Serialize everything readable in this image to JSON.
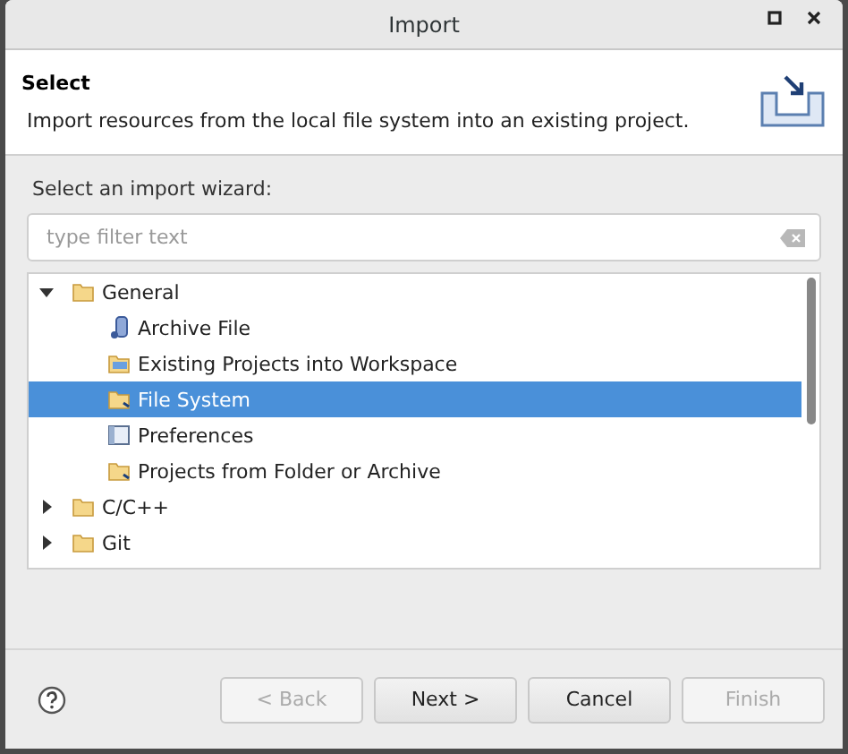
{
  "window": {
    "title": "Import"
  },
  "header": {
    "title": "Select",
    "description": "Import resources from the local file system into an existing project."
  },
  "wizard_label": "Select an import wizard:",
  "filter": {
    "placeholder": "type filter text"
  },
  "tree": [
    {
      "label": "General",
      "expanded": true,
      "selected": false,
      "children": [
        {
          "label": "Archive File",
          "kind": "archive",
          "selected": false
        },
        {
          "label": "Existing Projects into Workspace",
          "kind": "projects",
          "selected": false
        },
        {
          "label": "File System",
          "kind": "folder",
          "selected": true
        },
        {
          "label": "Preferences",
          "kind": "preferences",
          "selected": false
        },
        {
          "label": "Projects from Folder or Archive",
          "kind": "folder",
          "selected": false
        }
      ]
    },
    {
      "label": "C/C++",
      "expanded": false,
      "selected": false
    },
    {
      "label": "Git",
      "expanded": false,
      "selected": false
    }
  ],
  "buttons": [
    {
      "label": "< Back",
      "disabled": true
    },
    {
      "label": "Next >",
      "disabled": false
    },
    {
      "label": "Cancel",
      "disabled": false
    },
    {
      "label": "Finish",
      "disabled": true
    }
  ]
}
